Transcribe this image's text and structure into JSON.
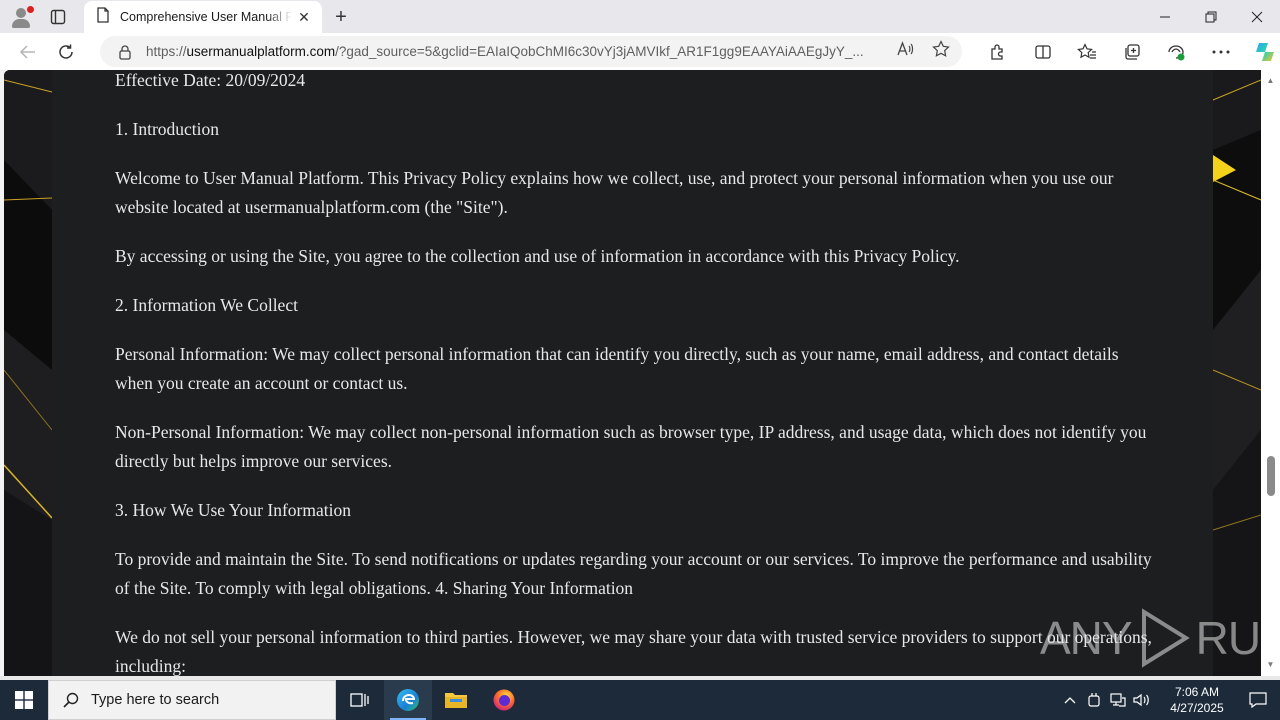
{
  "browser": {
    "tab": {
      "title": "Comprehensive User Manual Platform"
    },
    "address": {
      "url_prefix": "https://",
      "url_host": "usermanualplatform.com",
      "url_rest": "/?gad_source=5&gclid=EAIaIQobChMI6c30vYj3jAMVIkf_AR1F1gg9EAAYAiAAEgJyY_..."
    }
  },
  "document": {
    "paragraphs": [
      "Effective Date: 20/09/2024",
      "1. Introduction",
      "Welcome to User Manual Platform. This Privacy Policy explains how we collect, use, and protect your personal information when you use our website located at usermanualplatform.com (the \"Site\").",
      "By accessing or using the Site, you agree to the collection and use of information in accordance with this Privacy Policy.",
      "2. Information We Collect",
      "Personal Information: We may collect personal information that can identify you directly, such as your name, email address, and contact details when you create an account or contact us.",
      "Non-Personal Information: We may collect non-personal information such as browser type, IP address, and usage data, which does not identify you directly but helps improve our services.",
      "3. How We Use Your Information",
      "To provide and maintain the Site. To send notifications or updates regarding your account or our services. To improve the performance and usability of the Site. To comply with legal obligations. 4. Sharing Your Information",
      "We do not sell your personal information to third parties. However, we may share your data with trusted service providers to support our operations, including:"
    ]
  },
  "watermark": {
    "left": "ANY",
    "right": "RUN"
  },
  "taskbar": {
    "search_placeholder": "Type here to search",
    "time": "7:06 AM",
    "date": "4/27/2025"
  },
  "colors": {
    "page_panel": "#1d1e20",
    "accent_gold": "#f2d21b",
    "taskbar": "#1c2a3a"
  }
}
